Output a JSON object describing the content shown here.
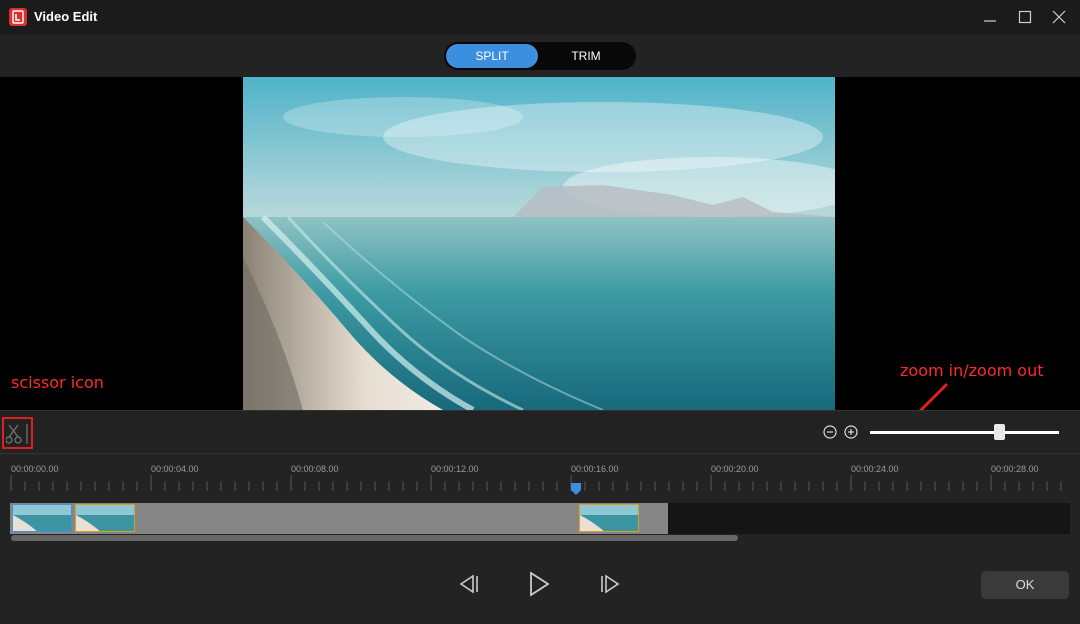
{
  "window": {
    "title": "Video Edit"
  },
  "tabs": [
    {
      "label": "SPLIT",
      "active": true
    },
    {
      "label": "TRIM",
      "active": false
    }
  ],
  "annotations": {
    "scissor": "scissor icon",
    "zoom": "zoom in/zoom out"
  },
  "zoom": {
    "level": 0.68
  },
  "timeline": {
    "tick_labels": [
      "00:00:00.00",
      "00:00:04.00",
      "00:00:08.00",
      "00:00:12.00",
      "00:00:16.00",
      "00:00:20.00",
      "00:00:24.00",
      "00:00:28.00"
    ],
    "playhead": "00:00:16.00"
  },
  "controls": {
    "ok_label": "OK"
  },
  "colors": {
    "accent": "#3c8fde",
    "annotation": "#ff2a2a",
    "clip_border": "#d9a21b",
    "app_logo": "#e02d2d"
  },
  "icons": [
    "app-logo-icon",
    "minimize-icon",
    "maximize-icon",
    "close-icon",
    "scissor-icon",
    "zoom-out-icon",
    "zoom-in-icon",
    "previous-frame-icon",
    "play-icon",
    "next-frame-icon"
  ]
}
